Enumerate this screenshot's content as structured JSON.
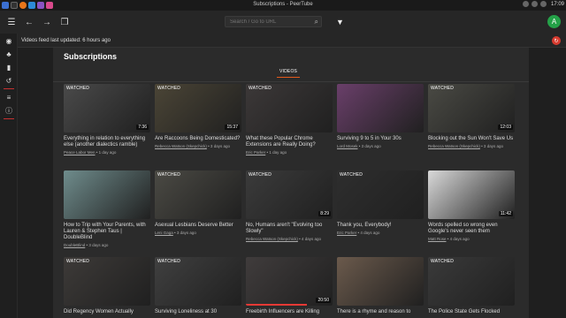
{
  "window": {
    "title": "Subscriptions - PeerTube",
    "clock": "17:09"
  },
  "header": {
    "search_placeholder": "Search / Go to URL",
    "avatar_letter": "A"
  },
  "notice": {
    "text": "Videos feed last updated: 6 hours ago"
  },
  "page": {
    "title": "Subscriptions",
    "tab": "VIDEOS"
  },
  "colors": {
    "accent": "#e55a1b",
    "avatar": "#24a148",
    "close": "#d63b2f"
  },
  "videos": [
    {
      "title": "Everything in relation to everything else (another dialectics ramble)",
      "channel": "Peace Labor Men",
      "age": "1 day ago",
      "watched": true,
      "duration": "7:36",
      "color": "#4a4a4a",
      "progress": 0
    },
    {
      "title": "Are Raccoons Being Domesticated?",
      "channel": "Rebecca Watson (Skepchick)",
      "age": "3 days ago",
      "watched": true,
      "duration": "15:37",
      "color": "#4b4536",
      "progress": 0
    },
    {
      "title": "What these Popular Chrome Extensions are Really Doing?",
      "channel": "Eric Parker",
      "age": "1 day ago",
      "watched": true,
      "duration": "",
      "color": "#3c3838",
      "progress": 0
    },
    {
      "title": "Surviving 9 to 5 in Your 30s",
      "channel": "Lord Mosek",
      "age": "3 days ago",
      "watched": false,
      "duration": "",
      "color": "#6a3f6a",
      "progress": 0
    },
    {
      "title": "Blocking out the Sun Won't Save Us",
      "channel": "Rebecca Watson (Skepchick)",
      "age": "3 days ago",
      "watched": true,
      "duration": "12:03",
      "color": "#4a4a44",
      "progress": 0
    },
    {
      "title": "How to Trip with Your Parents, with Lauren & Stephen Taus | DoubleBlind",
      "channel": "DoubleBlind",
      "age": "3 days ago",
      "watched": false,
      "duration": "",
      "color": "#6f8c8c",
      "progress": 0
    },
    {
      "title": "Asexual Lesbians Deserve Better",
      "channel": "Leni Gaga",
      "age": "3 days ago",
      "watched": true,
      "duration": "",
      "color": "#4b4a44",
      "progress": 0
    },
    {
      "title": "No, Humans aren't \"Evolving too Slowly\"",
      "channel": "Rebecca Watson (Skepchick)",
      "age": "4 days ago",
      "watched": true,
      "duration": "8:29",
      "color": "#3b3b3b",
      "progress": 0
    },
    {
      "title": "Thank you, Everybody!",
      "channel": "Eric Parker",
      "age": "4 days ago",
      "watched": true,
      "duration": "",
      "color": "#2e2e2e",
      "progress": 0
    },
    {
      "title": "Words spelled so wrong even Google's never seen them",
      "channel": "Matt Rose",
      "age": "4 days ago",
      "watched": false,
      "duration": "11:42",
      "color": "#d9d9d9",
      "progress": 0
    },
    {
      "title": "Did Regency Women Actually",
      "channel": "",
      "age": "",
      "watched": true,
      "duration": "",
      "color": "#3d3a38",
      "progress": 0
    },
    {
      "title": "Surviving Loneliness at 30",
      "channel": "",
      "age": "",
      "watched": true,
      "duration": "",
      "color": "#404040",
      "progress": 0
    },
    {
      "title": "Freebirth Influencers are Killing",
      "channel": "",
      "age": "",
      "watched": false,
      "duration": "20:50",
      "color": "#403c3c",
      "progress": 0.7
    },
    {
      "title": "There is a rhyme and reason to",
      "channel": "",
      "age": "",
      "watched": false,
      "duration": "",
      "color": "#6b5a4c",
      "progress": 0
    },
    {
      "title": "The Police State Gets Flocked",
      "channel": "",
      "age": "",
      "watched": true,
      "duration": "",
      "color": "#3a3a3a",
      "progress": 0
    }
  ]
}
